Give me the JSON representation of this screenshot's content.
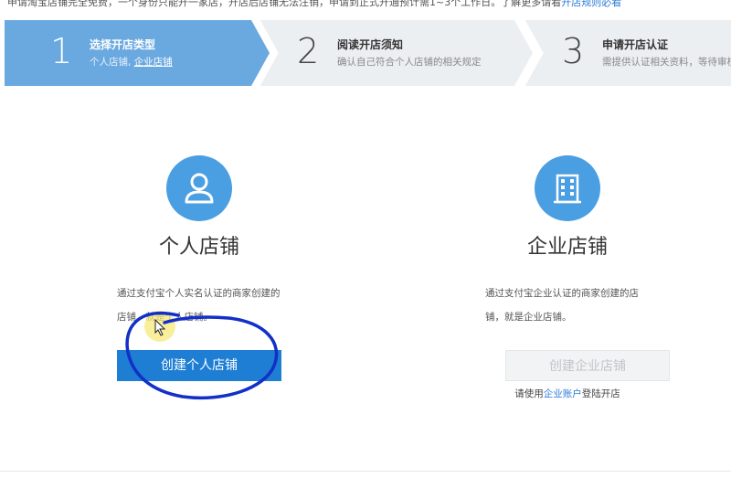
{
  "notice": {
    "text": "申请淘宝店铺完全免费，一个身份只能开一家店，开店后店铺无法注销，申请到正式开通预计需1~3个工作日。了解更多请看",
    "link": "开店规则必看"
  },
  "steps": [
    {
      "number": "1",
      "title": "选择开店类型",
      "desc_prefix": "个人店铺, ",
      "desc_link": "企业店铺",
      "active": true
    },
    {
      "number": "2",
      "title": "阅读开店须知",
      "desc": "确认自己符合个人店铺的相关规定",
      "active": false
    },
    {
      "number": "3",
      "title": "申请开店认证",
      "desc": "需提供认证相关资料，等待审核通过",
      "active": false
    }
  ],
  "personal": {
    "icon": "user-icon",
    "title": "个人店铺",
    "desc": "通过支付宝个人实名认证的商家创建的店铺，就是个人店铺。",
    "button": "创建个人店铺"
  },
  "enterprise": {
    "icon": "building-icon",
    "title": "企业店铺",
    "desc": "通过支付宝企业认证的商家创建的店铺，就是企业店铺。",
    "button": "创建企业店铺",
    "helper_prefix": "请使用",
    "helper_link": "企业账户",
    "helper_suffix": "登陆开店"
  },
  "colors": {
    "active_step": "#6aa9e0",
    "inactive_step": "#eceff2",
    "primary": "#1d7ed4",
    "icon_circle": "#4a9ee2",
    "annotation": "#1230c8",
    "cursor_highlight": "#f7e97a"
  }
}
